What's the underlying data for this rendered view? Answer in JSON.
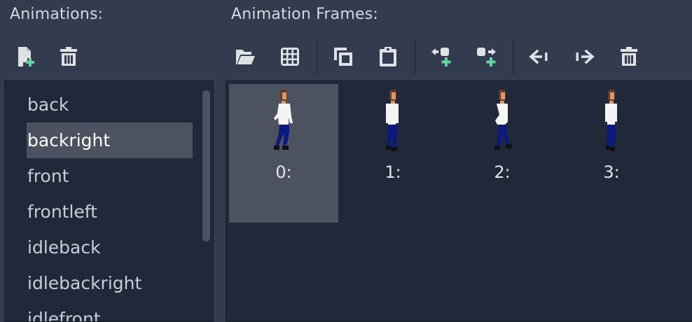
{
  "animations": {
    "label": "Animations:",
    "toolbar": [
      {
        "name": "new-animation-button",
        "icon": "new-file-icon"
      },
      {
        "name": "delete-animation-button",
        "icon": "trash-icon"
      }
    ],
    "items": [
      {
        "label": "back",
        "selected": false
      },
      {
        "label": "backright",
        "selected": true
      },
      {
        "label": "front",
        "selected": false
      },
      {
        "label": "frontleft",
        "selected": false
      },
      {
        "label": "idleback",
        "selected": false
      },
      {
        "label": "idlebackright",
        "selected": false
      },
      {
        "label": "idlefront",
        "selected": false
      }
    ]
  },
  "frames": {
    "label": "Animation Frames:",
    "toolbar": [
      {
        "name": "load-frames-button",
        "icon": "folder-open-icon"
      },
      {
        "name": "add-from-sheet-button",
        "icon": "grid-icon"
      },
      {
        "name": "copy-frame-button",
        "icon": "copy-icon"
      },
      {
        "name": "paste-frame-button",
        "icon": "paste-icon"
      },
      {
        "name": "insert-before-button",
        "icon": "insert-before-icon"
      },
      {
        "name": "insert-after-button",
        "icon": "insert-after-icon"
      },
      {
        "name": "move-left-button",
        "icon": "move-left-icon"
      },
      {
        "name": "move-right-button",
        "icon": "move-right-icon"
      },
      {
        "name": "delete-frame-button",
        "icon": "trash-icon"
      }
    ],
    "items": [
      {
        "label": "0:",
        "selected": true
      },
      {
        "label": "1:",
        "selected": false
      },
      {
        "label": "2:",
        "selected": false
      },
      {
        "label": "3:",
        "selected": false
      }
    ]
  },
  "colors": {
    "background": "#333b4f",
    "panel": "#21283a",
    "selection": "#4c5260",
    "add_accent": "#5fd6a0",
    "shirt": "#f4f4f4",
    "pants": "#0c1a7e",
    "hair": "#6b3a1e",
    "skin": "#d49a74"
  }
}
